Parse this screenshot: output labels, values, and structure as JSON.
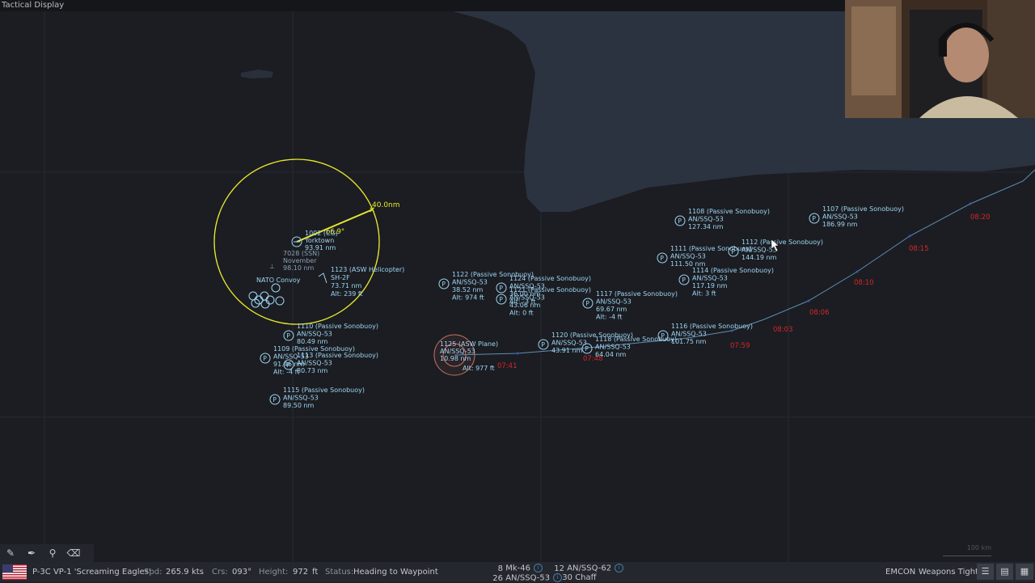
{
  "window": {
    "title": "Tactical Display"
  },
  "range_ring": {
    "distance_label": "40.0nm",
    "bearing_label": "66.9°"
  },
  "contacts": {
    "yorktown": {
      "id": "1002 (CG)",
      "name": "Yorktown",
      "range": "93.91 nm"
    },
    "ssn": {
      "id": "7028 (SSN)",
      "name": "November",
      "range": "98.10 nm"
    },
    "convoy": {
      "name": "NATO Convoy"
    },
    "helo": {
      "id": "1123 (ASW Helicopter)",
      "type": "SH-2F",
      "range": "73.71 nm",
      "alt": "Alt: 239 ft"
    },
    "own": {
      "id": "1125 (ASW Plane)",
      "type": "AN/SSQ-53",
      "range": "10.98 nm",
      "alt": "Alt: 977 ft"
    }
  },
  "buoys": [
    {
      "id": "1110 (Passive Sonobuoy)",
      "type": "AN/SSQ-53",
      "range": "80.49 nm"
    },
    {
      "id": "1109 (Passive Sonobuoy)",
      "type": "AN/SSQ-53",
      "range": "91.46 nm",
      "alt": "Alt: -4 ft"
    },
    {
      "id": "1113 (Passive Sonobuoy)",
      "type": "AN/SSQ-53",
      "range": "80.73 nm"
    },
    {
      "id": "1115 (Passive Sonobuoy)",
      "type": "AN/SSQ-53",
      "range": "89.50 nm"
    },
    {
      "id": "1122 (Passive Sonobuoy)",
      "type": "AN/SSQ-53",
      "range": "38.52 nm",
      "alt": "Alt: 974 ft"
    },
    {
      "id": "1124 (Passive Sonobuoy)",
      "type": "AN/SSQ-53",
      "range": "36.00 nm",
      "alt": "Alt: -3 ft"
    },
    {
      "id": "1121 (Passive Sonobuoy)",
      "type": "AN/SSQ-53",
      "range": "43.06 nm",
      "alt": "Alt: 0 ft"
    },
    {
      "id": "1117 (Passive Sonobuoy)",
      "type": "AN/SSQ-53",
      "range": "69.67 nm",
      "alt": "Alt: -4 ft"
    },
    {
      "id": "1120 (Passive Sonobuoy)",
      "type": "AN/SSQ-53",
      "range": "43.91 nm"
    },
    {
      "id": "1118 (Passive Sonobuoy)",
      "type": "AN/SSQ-53",
      "range": "64.04 nm"
    },
    {
      "id": "1116 (Passive Sonobuoy)",
      "type": "AN/SSQ-53",
      "range": "101.75 nm"
    },
    {
      "id": "1108 (Passive Sonobuoy)",
      "type": "AN/SSQ-53",
      "range": "127.34 nm"
    },
    {
      "id": "1111 (Passive Sonobuoy)",
      "type": "AN/SSQ-53",
      "range": "111.50 nm"
    },
    {
      "id": "1112 (Passive Sonobuoy)",
      "type": "AN/SSQ-53",
      "range": "144.19 nm"
    },
    {
      "id": "1114 (Passive Sonobuoy)",
      "type": "AN/SSQ-53",
      "range": "117.19 nm",
      "alt": "Alt: 3 ft"
    },
    {
      "id": "1107 (Passive Sonobuoy)",
      "type": "AN/SSQ-53",
      "range": "186.99 nm"
    }
  ],
  "waypoint_times": [
    "07:41",
    "07:48",
    "07:59",
    "08:03",
    "08:06",
    "08:10",
    "08:15",
    "08:20"
  ],
  "scale_bar": "100 km",
  "status": {
    "unit_name": "P-3C VP-1 'Screaming Eagles'",
    "speed_label": "Spd:",
    "speed_value": "265.9",
    "speed_unit": "kts",
    "course_label": "Crs:",
    "course_value": "093°",
    "height_label": "Height:",
    "height_value": "972",
    "height_unit": "ft",
    "status_label": "Status:",
    "status_value": "Heading to Waypoint",
    "emcon": "EMCON",
    "weapons": "Weapons Tight"
  },
  "ordnance": [
    {
      "count": "8",
      "name": "Mk-46"
    },
    {
      "count": "12",
      "name": "AN/SSQ-62"
    },
    {
      "count": "26",
      "name": "AN/SSQ-53"
    },
    {
      "count": "30",
      "name": "Chaff"
    }
  ],
  "colors": {
    "map_bg": "#1b1d22",
    "land": "#2c3340",
    "contact": "#9fd4f2",
    "range_ring": "#e8e82e",
    "waypoint": "#d6262b"
  }
}
